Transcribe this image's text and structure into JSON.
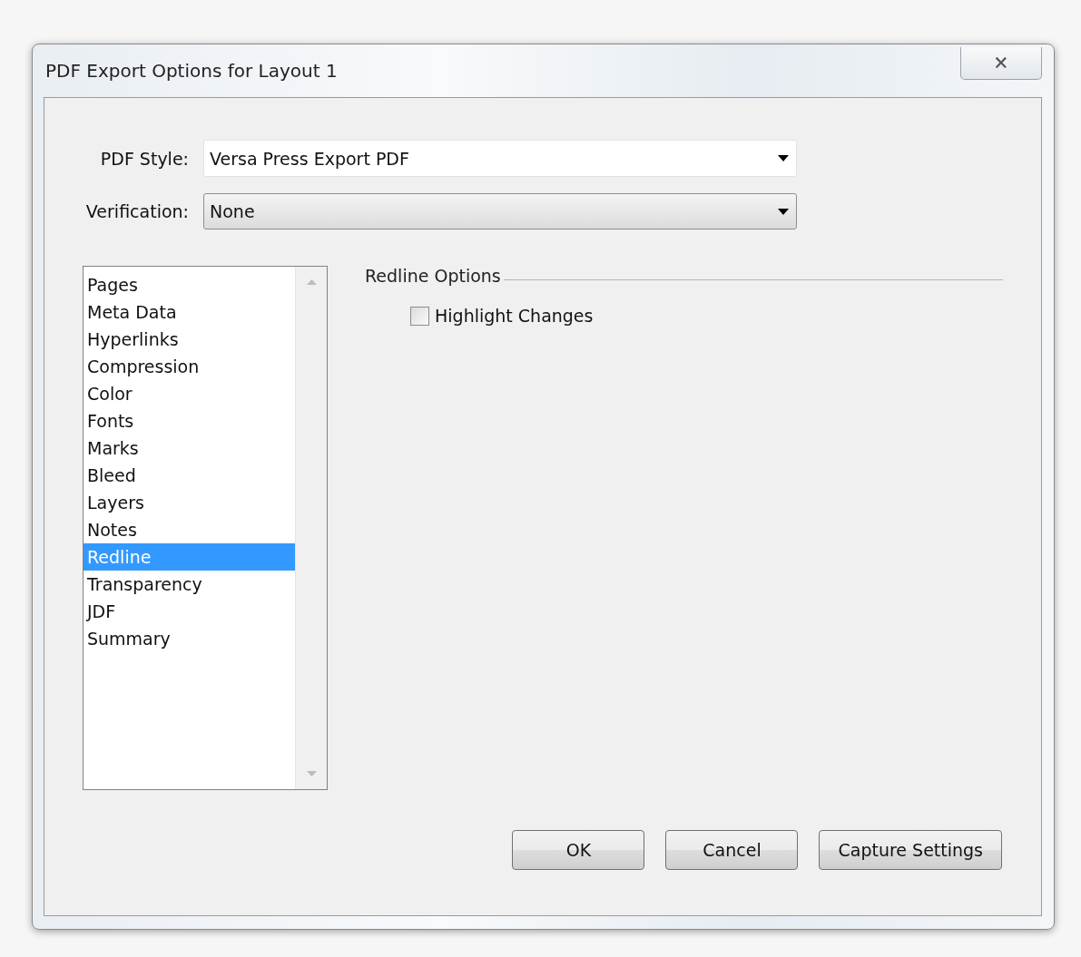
{
  "window": {
    "title": "PDF Export Options for Layout 1",
    "close_glyph": "🗙"
  },
  "fields": [
    {
      "kind": "text",
      "label": "PDF Style:",
      "value": "Versa Press Export PDF"
    },
    {
      "kind": "button",
      "label": "Verification:",
      "value": "None"
    }
  ],
  "sidebar": {
    "items": [
      {
        "label": "Pages",
        "selected": false
      },
      {
        "label": "Meta Data",
        "selected": false
      },
      {
        "label": "Hyperlinks",
        "selected": false
      },
      {
        "label": "Compression",
        "selected": false
      },
      {
        "label": "Color",
        "selected": false
      },
      {
        "label": "Fonts",
        "selected": false
      },
      {
        "label": "Marks",
        "selected": false
      },
      {
        "label": "Bleed",
        "selected": false
      },
      {
        "label": "Layers",
        "selected": false
      },
      {
        "label": "Notes",
        "selected": false
      },
      {
        "label": "Redline",
        "selected": true
      },
      {
        "label": "Transparency",
        "selected": false
      },
      {
        "label": "JDF",
        "selected": false
      },
      {
        "label": "Summary",
        "selected": false
      }
    ]
  },
  "section": {
    "title": "Redline Options",
    "options": [
      {
        "label": "Highlight Changes",
        "checked": false
      }
    ]
  },
  "buttons": [
    "OK",
    "Cancel",
    "Capture Settings"
  ]
}
